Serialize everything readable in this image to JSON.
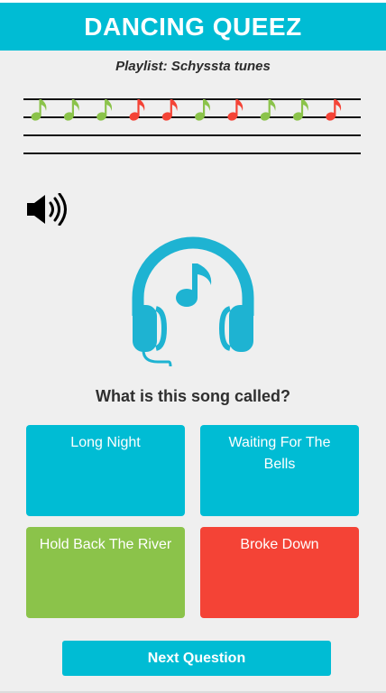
{
  "app": {
    "title": "DANCING QUEEZ"
  },
  "playlist": {
    "label": "Playlist: Schyssta tunes"
  },
  "staff": {
    "notes": [
      {
        "status": "correct"
      },
      {
        "status": "correct"
      },
      {
        "status": "correct"
      },
      {
        "status": "wrong"
      },
      {
        "status": "wrong"
      },
      {
        "status": "correct"
      },
      {
        "status": "wrong"
      },
      {
        "status": "correct"
      },
      {
        "status": "correct"
      },
      {
        "status": "wrong"
      }
    ]
  },
  "icons": {
    "speaker": "speaker-icon",
    "headphones": "headphones-music-icon"
  },
  "question": {
    "text": "What is this song called?"
  },
  "answers": [
    {
      "label": "Long Night",
      "state": "neutral"
    },
    {
      "label": "Waiting For The Bells",
      "state": "neutral"
    },
    {
      "label": "Hold Back The River",
      "state": "correct"
    },
    {
      "label": "Broke Down",
      "state": "wrong"
    }
  ],
  "next_button": {
    "label": "Next Question"
  },
  "colors": {
    "accent": "#00bcd4",
    "correct": "#8bc34a",
    "wrong": "#f44336",
    "background": "#efefef"
  }
}
